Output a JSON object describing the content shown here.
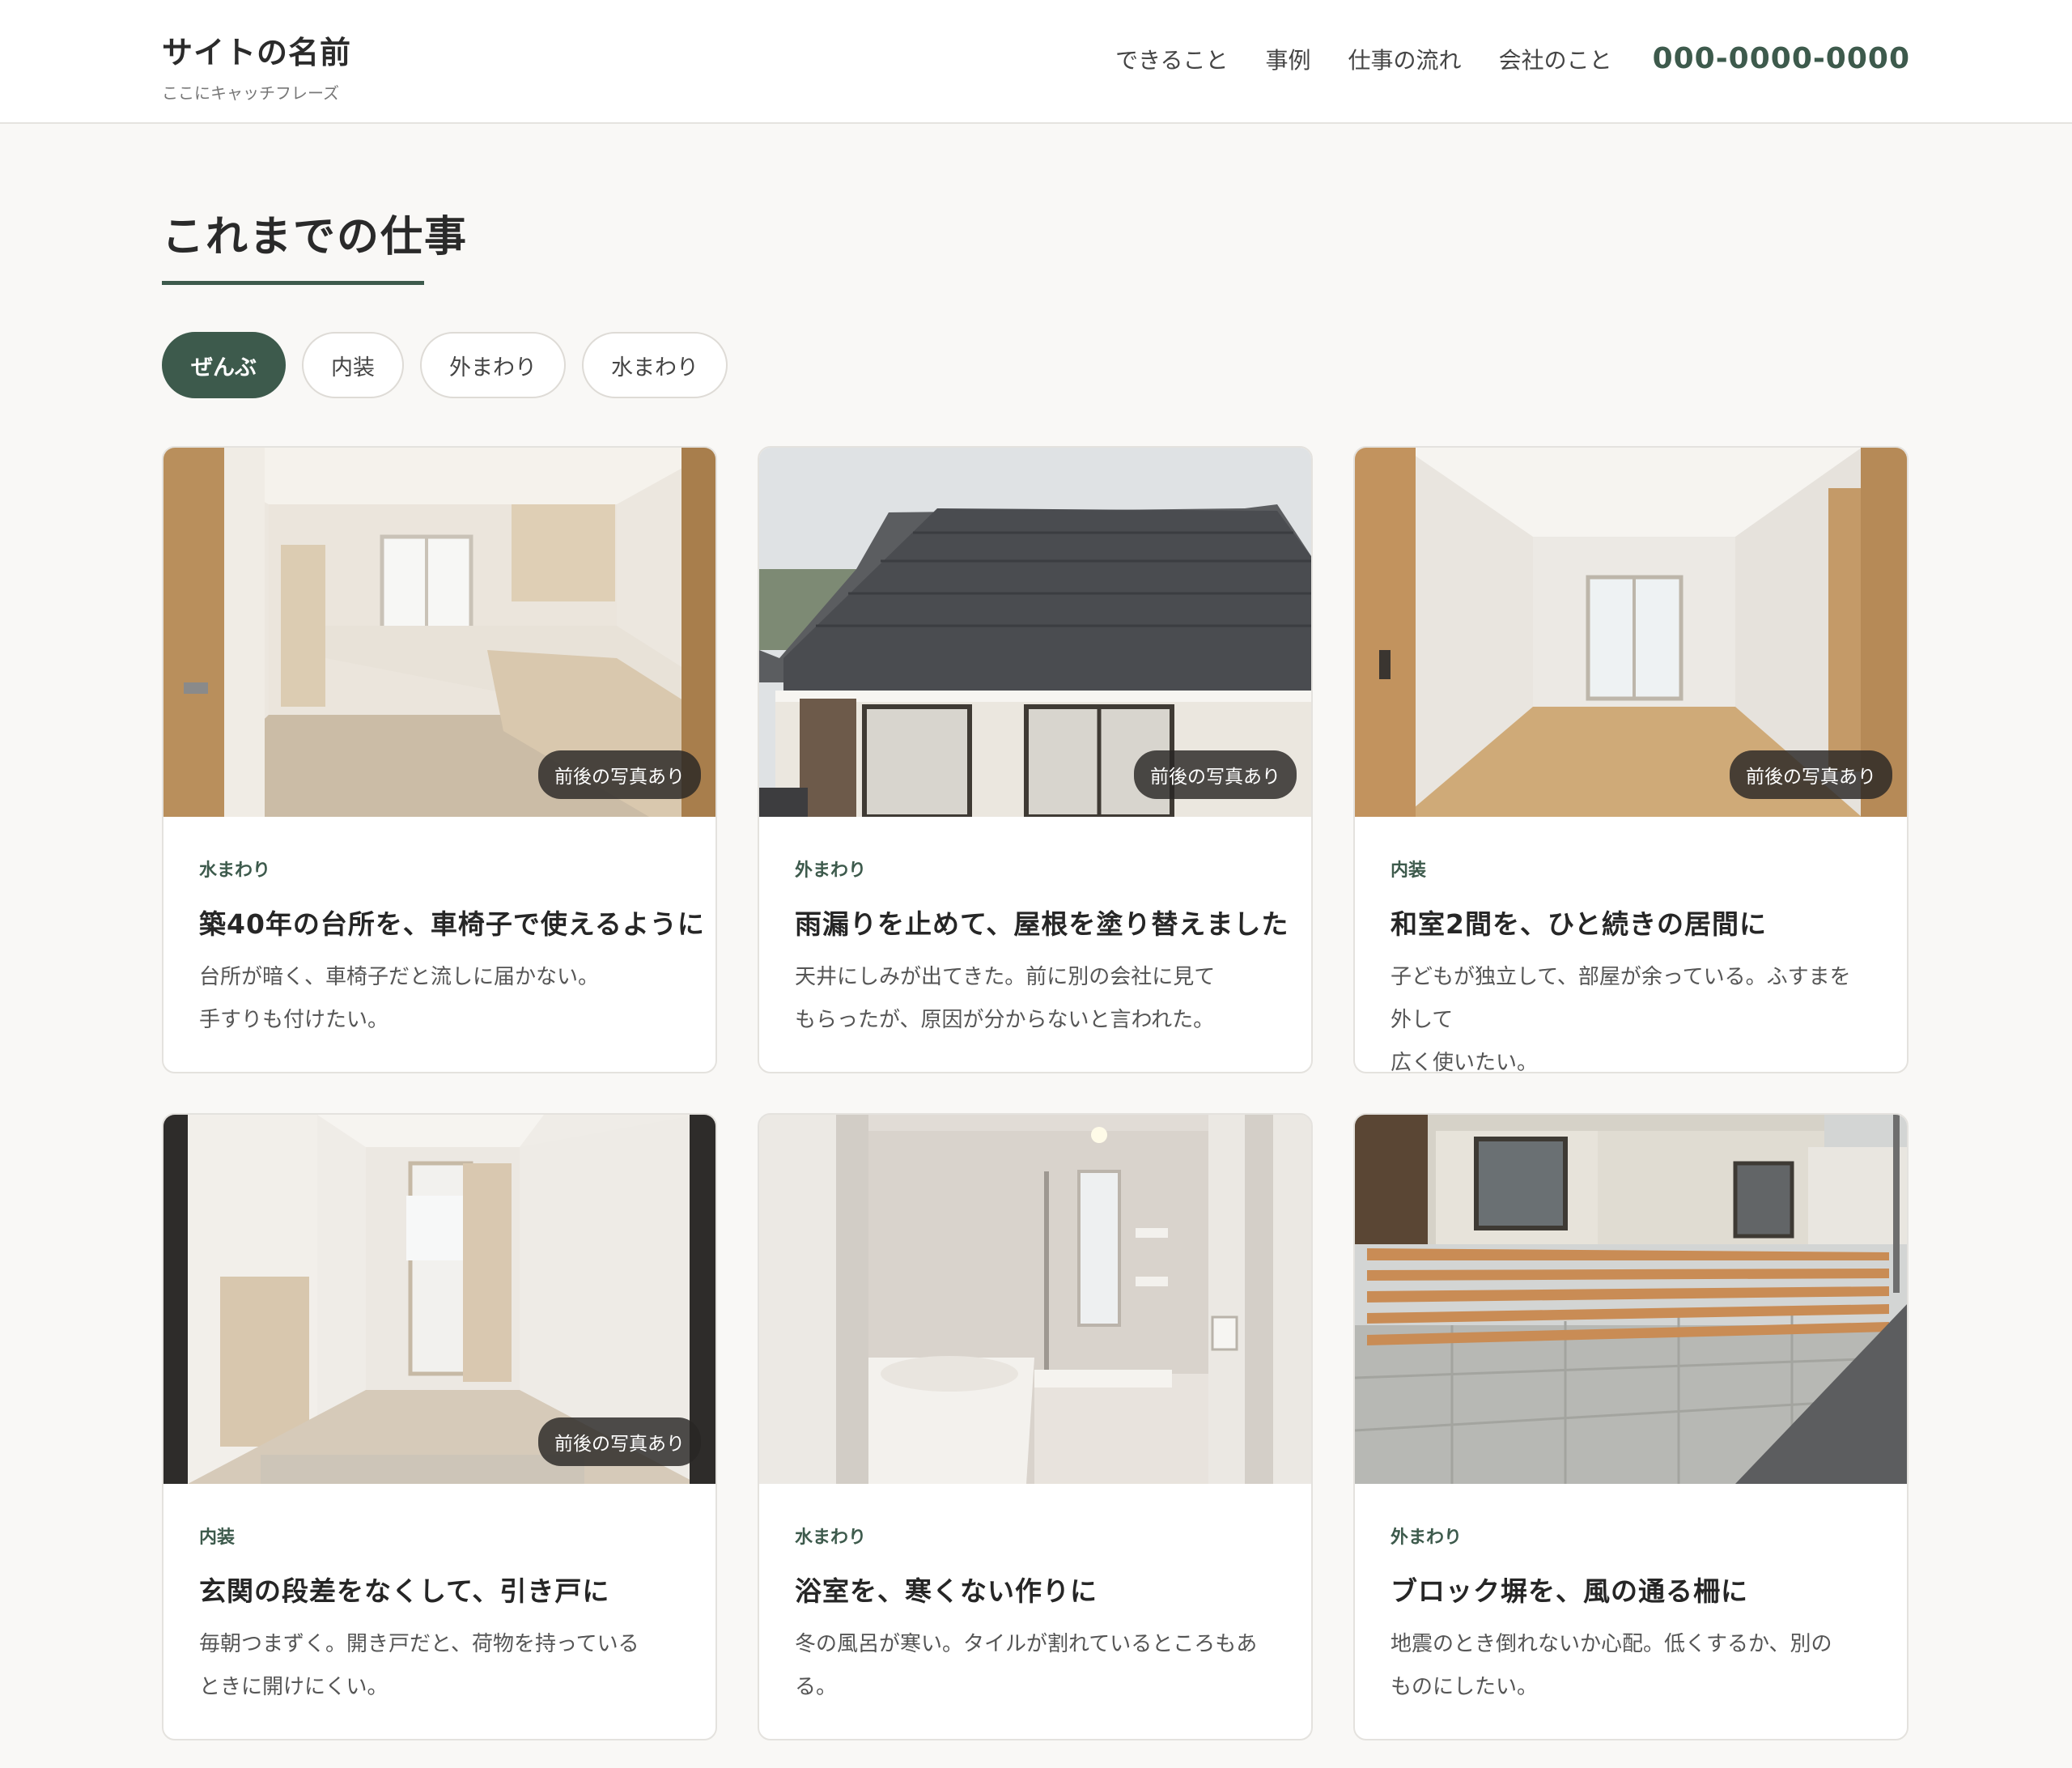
{
  "header": {
    "site_name": "サイトの名前",
    "tagline": "ここにキャッチフレーズ",
    "nav": [
      "できること",
      "事例",
      "仕事の流れ",
      "会社のこと"
    ],
    "phone": "000-0000-0000"
  },
  "section": {
    "title": "これまでの仕事"
  },
  "filters": [
    "ぜんぶ",
    "内装",
    "外まわり",
    "水まわり"
  ],
  "active_filter": "ぜんぶ",
  "cards": [
    {
      "category": "水まわり",
      "title": "築40年の台所を、車椅子で使えるように",
      "desc": [
        "台所が暗く、車椅子だと流しに届かない。",
        "手すりも付けたい。"
      ],
      "badge": "前後の写真あり",
      "photo": "kitchen-photo"
    },
    {
      "category": "外まわり",
      "title": "雨漏りを止めて、屋根を塗り替えました",
      "desc": [
        "天井にしみが出てきた。前に別の会社に見て",
        "もらったが、原因が分からないと言われた。"
      ],
      "badge": "前後の写真あり",
      "photo": "roof-photo"
    },
    {
      "category": "内装",
      "title": "和室2間を、ひと続きの居間に",
      "desc": [
        "子どもが独立して、部屋が余っている。ふすまを外して",
        "広く使いたい。"
      ],
      "badge": "前後の写真あり",
      "photo": "living-room-photo"
    },
    {
      "category": "内装",
      "title": "玄関の段差をなくして、引き戸に",
      "desc": [
        "毎朝つまずく。開き戸だと、荷物を持っている",
        "ときに開けにくい。"
      ],
      "badge": "前後の写真あり",
      "photo": "entrance-photo"
    },
    {
      "category": "水まわり",
      "title": "浴室を、寒くない作りに",
      "desc": [
        "冬の風呂が寒い。タイルが割れているところもある。"
      ],
      "badge": "",
      "photo": "bathroom-photo"
    },
    {
      "category": "外まわり",
      "title": "ブロック塀を、風の通る柵に",
      "desc": [
        "地震のとき倒れないか心配。低くするか、別の",
        "ものにしたい。"
      ],
      "badge": "",
      "photo": "fence-photo"
    }
  ],
  "colors": {
    "accent": "#3d5a4c",
    "background": "#f9f8f6",
    "badge": "#2f2d2b"
  }
}
